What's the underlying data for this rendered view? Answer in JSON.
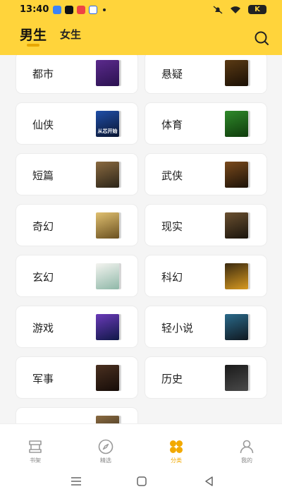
{
  "status_bar": {
    "time": "13:40",
    "battery": "K"
  },
  "header": {
    "tabs": [
      {
        "label": "男生",
        "active": true
      },
      {
        "label": "女生",
        "active": false
      }
    ],
    "search_icon": "search-icon",
    "accent_color": "#ffd43b"
  },
  "categories": [
    {
      "label": "都市",
      "cover": ""
    },
    {
      "label": "悬疑",
      "cover": ""
    },
    {
      "label": "仙侠",
      "cover": "从芯开始"
    },
    {
      "label": "体育",
      "cover": ""
    },
    {
      "label": "短篇",
      "cover": ""
    },
    {
      "label": "武侠",
      "cover": ""
    },
    {
      "label": "奇幻",
      "cover": ""
    },
    {
      "label": "现实",
      "cover": ""
    },
    {
      "label": "玄幻",
      "cover": ""
    },
    {
      "label": "科幻",
      "cover": ""
    },
    {
      "label": "游戏",
      "cover": ""
    },
    {
      "label": "轻小说",
      "cover": ""
    },
    {
      "label": "军事",
      "cover": ""
    },
    {
      "label": "历史",
      "cover": ""
    },
    {
      "label": "",
      "cover": ""
    }
  ],
  "bottom_nav": [
    {
      "label": "书架",
      "icon": "bookshelf-icon",
      "active": false
    },
    {
      "label": "精选",
      "icon": "compass-icon",
      "active": false
    },
    {
      "label": "分类",
      "icon": "category-icon",
      "active": true
    },
    {
      "label": "我的",
      "icon": "profile-icon",
      "active": false
    }
  ],
  "colors": {
    "accent": "#ffd43b",
    "active_nav": "#f2a900",
    "inactive_nav": "#888888"
  }
}
